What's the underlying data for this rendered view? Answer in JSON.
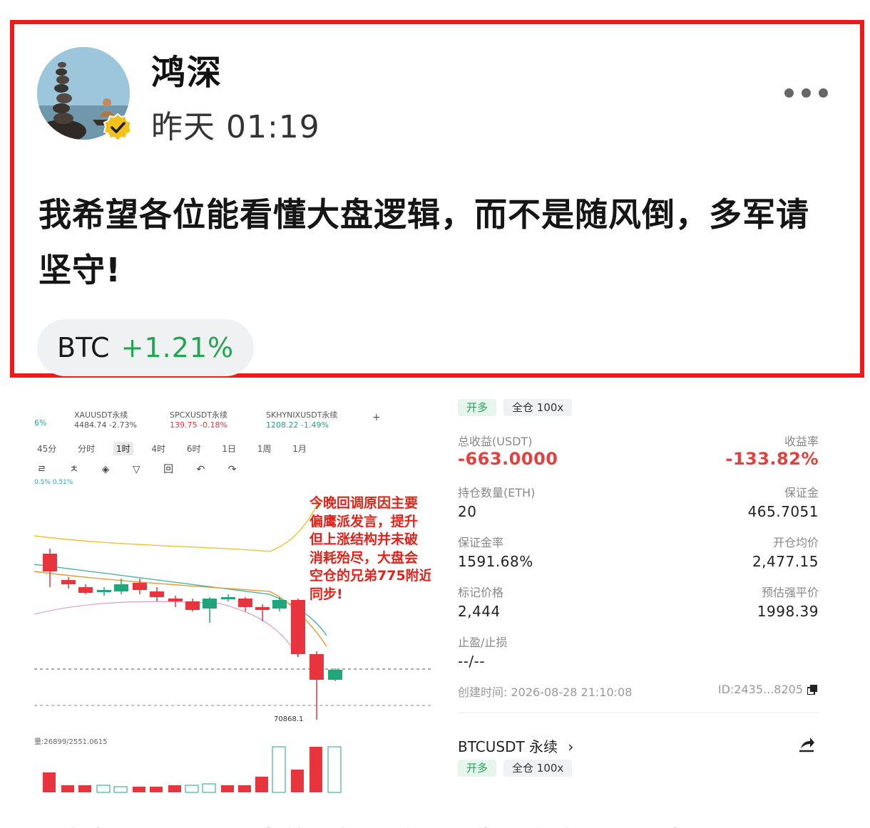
{
  "post": {
    "author": "鸿深",
    "time": "昨天 01:19",
    "content": "我希望各位能看懂大盘逻辑，而不是随风倒，多军请坚守!",
    "ticker": {
      "symbol": "BTC",
      "change": "+1.21%"
    }
  },
  "chart_panel": {
    "tickers": [
      {
        "name": "XAUUSDT永续",
        "value": "4484.74 -2.73%"
      },
      {
        "name": "SPCXUSDT永续",
        "value": "139.75 -0.18%"
      },
      {
        "name": "SKHYNIXUSDT永续",
        "value": "1208.22 -1.49%"
      }
    ],
    "left_edge_value": "6%",
    "add_symbol": "+",
    "timeframes": [
      "45分",
      "分时",
      "1时",
      "4时",
      "6时",
      "1日",
      "1周",
      "1月"
    ],
    "active_timeframe": "1时",
    "tool_icons": "ㄹ ㅊ ◈ ▽ 回 ↶ ↷",
    "indicator_label": "0.5% 0.51%",
    "annotation": [
      "今晚回调原因主要",
      "偏鹰派发言，提升",
      "但上涨结构并未破",
      "消耗殆尽，大盘会",
      "空仓的兄弟775附近",
      "同步!"
    ],
    "price_marker": "70868.1",
    "volume_label": "量:26899/2551.0615",
    "colors": {
      "up": "#1fa67a",
      "down": "#e8343c"
    }
  },
  "order_panel": {
    "tags": [
      "开多",
      "全仓 100x"
    ],
    "total_pnl_label": "总收益(USDT)",
    "total_pnl": "-663.0000",
    "roi_label": "收益率",
    "roi": "-133.82%",
    "qty_label": "持仓数量(ETH)",
    "qty": "20",
    "margin_label": "保证金",
    "margin": "465.7051",
    "margin_ratio_label": "保证金率",
    "margin_ratio": "1591.68%",
    "avg_price_label": "开仓均价",
    "avg_price": "2,477.15",
    "mark_price_label": "标记价格",
    "mark_price": "2,444",
    "liq_price_label": "预估强平价",
    "liq_price": "1998.39",
    "tpsl_label": "止盈/止损",
    "tpsl": "--/--",
    "created": "创建时间: 2026-08-28 21:10:08",
    "position_id": "ID:2435...8205",
    "next_contract": "BTCUSDT 永续",
    "next_tags": [
      "开多",
      "全仓 100x"
    ]
  },
  "bottom_text": "温馨提示：以下分享的面标评论仅代表平台内个人观点，与"
}
